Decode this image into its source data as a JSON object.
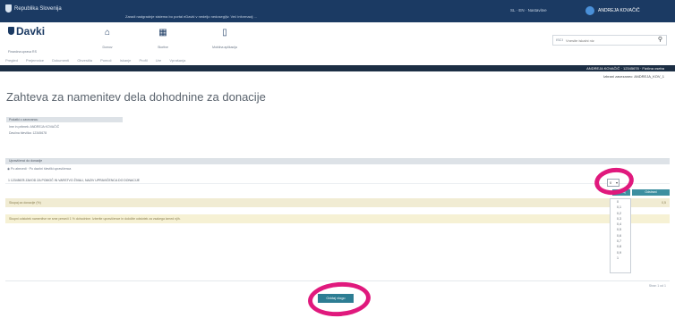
{
  "topbar": {
    "brand": "Republika Slovenija",
    "notice": "Zaradi nadgradnje sistema bo portal eDavki v nedeljo nedosegljiv. Več informacij ...",
    "tools": "SL · EN · Nastavitve",
    "user": "ANDREJA KOVAČIČ"
  },
  "header": {
    "logo": "Davki",
    "logo_sub": "Finančna uprava RS",
    "icons": [
      {
        "glyph": "⌂",
        "label": "Domov",
        "name": "home-icon"
      },
      {
        "glyph": "▦",
        "label": "Storitve",
        "name": "services-icon"
      },
      {
        "glyph": "▯",
        "label": "Mobilna aplikacija",
        "name": "mobile-icon"
      }
    ],
    "search_tag": "ISCI",
    "search_placeholder": "Vnesite iskalni niz"
  },
  "breadcrumbs": [
    "Pregled",
    "Prejemnice",
    "Dokumenti",
    "Obvestila",
    "Pomoč",
    "Iskanje",
    "Profil",
    "Ure",
    "Vprašanja"
  ],
  "darkstrip": {
    "info": "ANDREJA KOVAČIČ · 12345678 · Fizična oseba"
  },
  "subinfo": "Izbrani zavezanec: ANDREJA_KOV_1",
  "page_title": "Zahteva za namenitev dela dohodnine za donacije",
  "taxpayer": {
    "bar": "Podatki o zavezancu",
    "rows": [
      "Ime in priimek: ANDREJA KOVAČIČ",
      "Davčna številka: 12345678"
    ]
  },
  "section": {
    "bar": "Upravičenci do donacije",
    "radio": "◉ Po abecedi · Po davčni številki upravičenca",
    "row": "1   12345678   ZAVOD ZA POMOČ IN VARSTVO ŽIVALI, NAZIV UPRAVIČENCA DO DONACIJE"
  },
  "tan_row": {
    "label": "Skupaj za donacije (%)",
    "value": "0,5"
  },
  "warn_row": "Skupni odstotek namenitve ne sme preseči 1 % dohodnine. Izberite upravičence in določite odstotek za vsakega izmed njih.",
  "dropdown": {
    "selected": "0",
    "options": [
      "0",
      "0,1",
      "0,2",
      "0,3",
      "0,4",
      "0,5",
      "0,6",
      "0,7",
      "0,8",
      "0,9",
      "1"
    ],
    "btn_a": "Dodaj",
    "btn_b": "Odstrani"
  },
  "footer_note": "Stran 1 od 1",
  "submit_label": "Oddaj vlogo",
  "colors": {
    "brand": "#1b3a63",
    "accent": "#2d7d93",
    "annotation": "#e0197d",
    "tan": "#f1ecd3"
  }
}
